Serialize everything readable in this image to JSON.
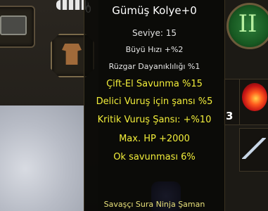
{
  "tooltip": {
    "title": "Gümüş Kolye+0",
    "level": "Seviye: 15",
    "base_stats": [
      "Büyü Hızı +%2",
      "Rüzgar Dayanıklılığı %1"
    ],
    "bonuses": [
      "Çift-El Savunma %15",
      "Delici Vuruş için şansı %5",
      "Kritik Vuruş Şansı: +%10",
      "Max. HP +2000",
      "Ok savunması 6%"
    ],
    "classes": "Savaşçı Sura Ninja Şaman"
  },
  "hud": {
    "skill_numeral": "II",
    "stack_count": "3",
    "top_count": "0"
  },
  "colors": {
    "bonus_text": "#f2ee3a",
    "title_text": "#ffffff",
    "tooltip_bg": "#080806"
  },
  "icons": [
    "chest-icon",
    "armor-icon",
    "fire-orb-icon",
    "swords-icon",
    "skill-emblem-icon",
    "necklace-icon"
  ]
}
